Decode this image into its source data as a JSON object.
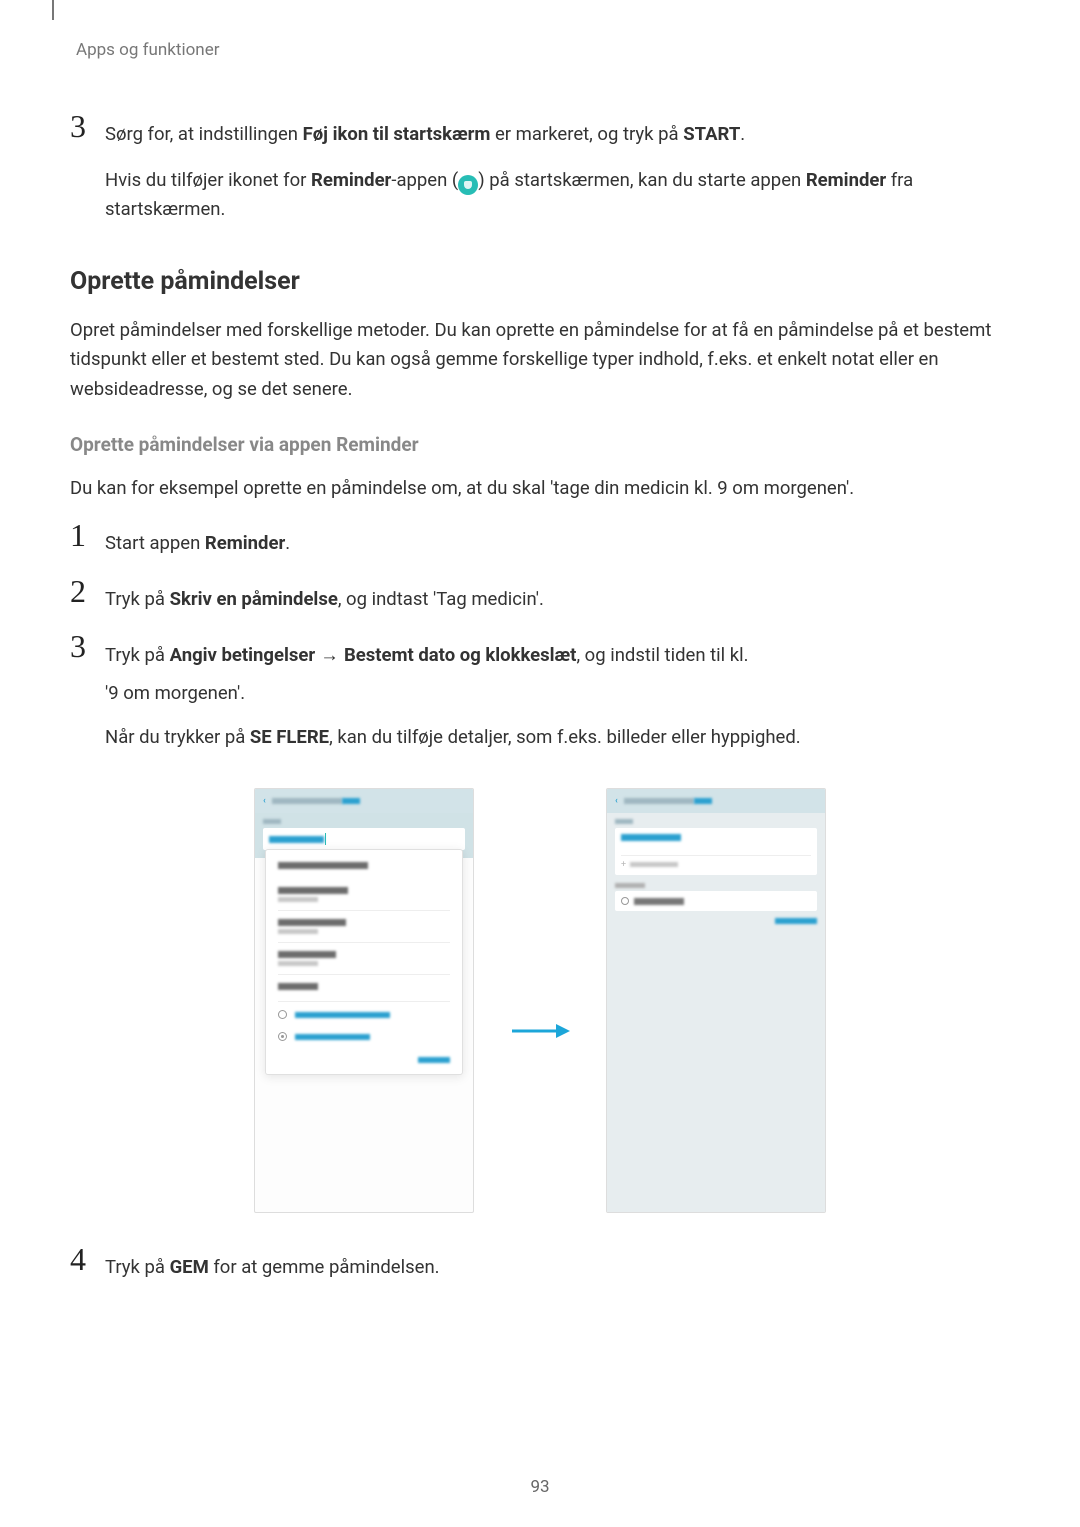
{
  "header": {
    "breadcrumb": "Apps og funktioner"
  },
  "step3top": {
    "num": "3",
    "line1_a": "Sørg for, at indstillingen ",
    "line1_b": "Føj ikon til startskærm",
    "line1_c": " er markeret, og tryk på ",
    "line1_d": "START",
    "line1_e": ".",
    "line2_a": "Hvis du tilføjer ikonet for ",
    "line2_b": "Reminder",
    "line2_c": "-appen (",
    "line2_d": ") på startskærmen, kan du starte appen ",
    "line2_e": "Reminder",
    "line2_f": " fra startskærmen."
  },
  "h2": "Oprette påmindelser",
  "para1": "Opret påmindelser med forskellige metoder. Du kan oprette en påmindelse for at få en påmindelse på et bestemt tidspunkt eller et bestemt sted. Du kan også gemme forskellige typer indhold, f.eks. et enkelt notat eller en websideadresse, og se det senere.",
  "h3": "Oprette påmindelser via appen Reminder",
  "para2": "Du kan for eksempel oprette en påmindelse om, at du skal 'tage din medicin kl. 9 om morgenen'.",
  "ol": {
    "s1": {
      "num": "1",
      "a": "Start appen ",
      "b": "Reminder",
      "c": "."
    },
    "s2": {
      "num": "2",
      "a": "Tryk på ",
      "b": "Skriv en påmindelse",
      "c": ", og indtast 'Tag medicin'."
    },
    "s3": {
      "num": "3",
      "a": "Tryk på ",
      "b": "Angiv betingelser",
      "arrow": " → ",
      "c": "Bestemt dato og klokkeslæt",
      "d": ", og indstil tiden til kl. ",
      "e": "'9 om morgenen'.",
      "f_a": "Når du trykker på ",
      "f_b": "SE FLERE",
      "f_c": ", kan du tilføje detaljer, som f.eks. billeder eller hyppighed."
    },
    "s4": {
      "num": "4",
      "a": "Tryk på ",
      "b": "GEM",
      "c": " for at gemme påmindelsen."
    }
  },
  "screenshots": {
    "left": {
      "back": "‹",
      "title": "CREATE REMINDER",
      "save": "SAVE",
      "memo": "MEMO",
      "input": "Take medicine",
      "popup_heading": "Reminder conditions",
      "opt1_t": "1 hour from now",
      "opt1_s": "1 Aug, 10:00",
      "opt2_t": "This afternoon",
      "opt2_s": "1 Aug, 13:00",
      "opt3_t": "This evening",
      "opt3_s": "1 Aug, 19:00",
      "opt4_t": "No alerts",
      "opt5_t": "Specific date and time",
      "opt6_t": "Specific location",
      "cancel": "CANCEL"
    },
    "right": {
      "back": "‹",
      "title": "CREATE REMINDER",
      "save": "SAVE",
      "memo": "MEMO",
      "input": "Take medicine",
      "checklist": "Add checklist",
      "cond": "CONDITIONS",
      "time": "2 Aug, 09:00",
      "viewmore": "VIEW MORE"
    }
  },
  "page_number": "93",
  "colors": {
    "accent": "#27bdb5",
    "link": "#2aa0d0"
  }
}
